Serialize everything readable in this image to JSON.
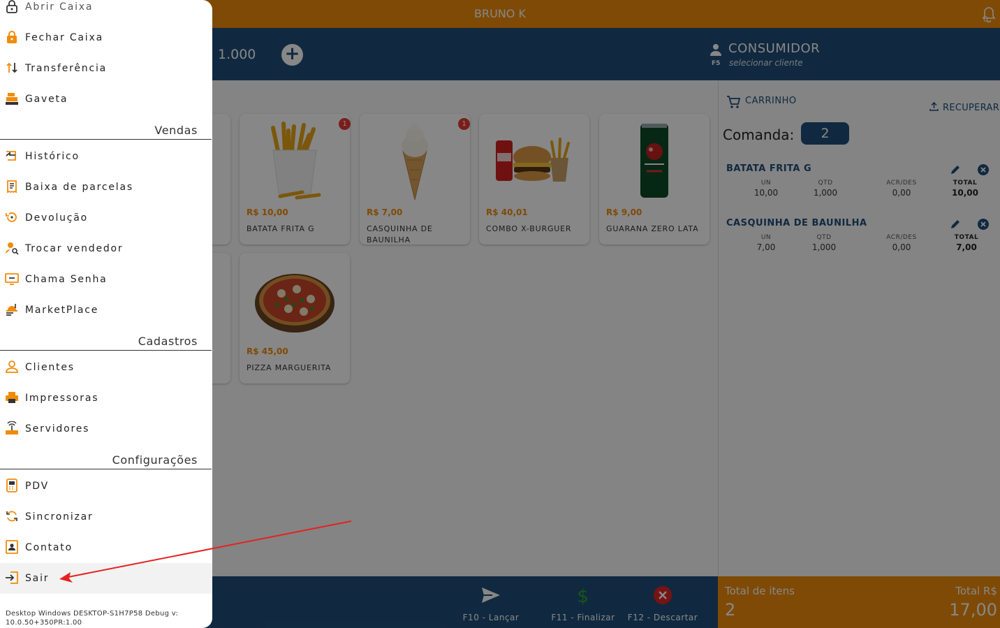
{
  "topbar": {
    "user_name": "BRUNO K",
    "notification_count": "0"
  },
  "header": {
    "quantity": "1.000",
    "customer": {
      "shortcut": "F5",
      "name": "CONSUMIDOR",
      "placeholder": "selecionar cliente"
    }
  },
  "products": [
    {
      "name": "BATATA FRITA G",
      "price": "R$ 10,00",
      "badge": "1"
    },
    {
      "name": "CASQUINHA DE BAUNILHA",
      "price": "R$ 7,00",
      "badge": "1"
    },
    {
      "name": "COMBO X-BURGUER",
      "price": "R$ 40,01",
      "badge": ""
    },
    {
      "name": "GUARANA ZERO LATA",
      "price": "R$ 9,00",
      "badge": ""
    },
    {
      "name": "PIZZA MARGUERITA",
      "price": "R$ 45,00",
      "badge": ""
    }
  ],
  "cart": {
    "title": "CARRINHO",
    "recover_label": "RECUPERAR",
    "comanda_label": "Comanda:",
    "comanda_value": "2",
    "columns": {
      "un": "UN",
      "qtd": "QTD",
      "acr": "ACR/DES",
      "total": "TOTAL"
    },
    "items": [
      {
        "name": "BATATA FRITA G",
        "un": "10,00",
        "qtd": "1,000",
        "acr": "0,00",
        "total": "10,00"
      },
      {
        "name": "CASQUINHA DE BAUNILHA",
        "un": "7,00",
        "qtd": "1,000",
        "acr": "0,00",
        "total": "7,00"
      }
    ]
  },
  "footer": {
    "launch_label": "F10 - Lançar",
    "finish_label": "F11 - Finalizar",
    "discard_label": "F12 - Descartar",
    "total_items_label": "Total de itens",
    "total_items_value": "2",
    "total_value_label": "Total R$",
    "total_value": "17,00"
  },
  "drawer": {
    "caixa_items": [
      "Abrir Caixa",
      "Fechar Caixa",
      "Transferência",
      "Gaveta"
    ],
    "section_vendas": "Vendas",
    "vendas_items": [
      "Histórico",
      "Baixa de parcelas",
      "Devolução",
      "Trocar vendedor",
      "Chama Senha",
      "MarketPlace"
    ],
    "section_cadastros": "Cadastros",
    "cadastros_items": [
      "Clientes",
      "Impressoras",
      "Servidores"
    ],
    "section_config": "Configurações",
    "config_items": [
      "PDV",
      "Sincronizar",
      "Contato",
      "Sair"
    ],
    "version": "Desktop Windows DESKTOP-S1H7P58 Debug v: 10.0.50+350PR:1.00"
  },
  "colors": {
    "accent": "#f08c0a",
    "primary": "#1f4f7a",
    "annotation": "#e52222"
  }
}
